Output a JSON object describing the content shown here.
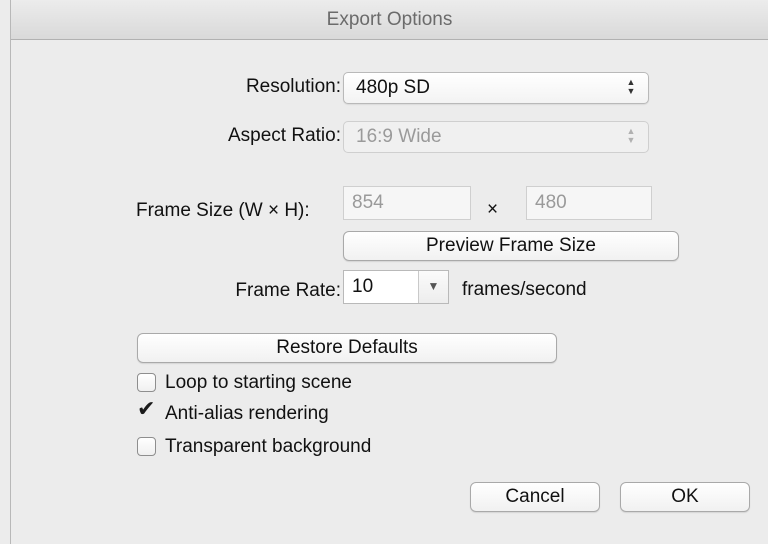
{
  "window": {
    "title": "Export Options"
  },
  "resolution": {
    "label": "Resolution:",
    "value": "480p SD"
  },
  "aspect_ratio": {
    "label": "Aspect Ratio:",
    "value": "16:9 Wide"
  },
  "frame_size": {
    "label": "Frame Size (W × H):",
    "width": "854",
    "times": "×",
    "height": "480"
  },
  "preview_button": {
    "label": "Preview Frame Size"
  },
  "frame_rate": {
    "label": "Frame Rate:",
    "value": "10",
    "unit": "frames/second"
  },
  "restore_button": {
    "label": "Restore Defaults"
  },
  "options": [
    {
      "label": "Loop to starting scene",
      "checked": false
    },
    {
      "label": "Anti-alias rendering",
      "checked": true
    },
    {
      "label": "Transparent background",
      "checked": false
    }
  ],
  "footer": {
    "cancel": "Cancel",
    "ok": "OK"
  }
}
